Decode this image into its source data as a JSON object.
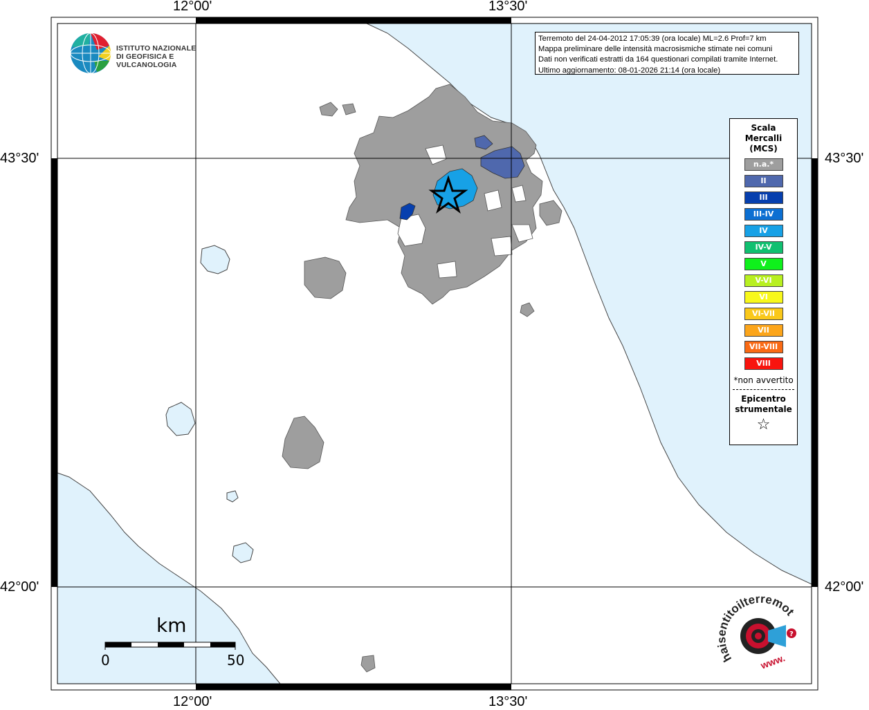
{
  "map": {
    "coordinates": {
      "lon_left": "12°00'",
      "lon_right": "13°30'",
      "lat_top": "43°30'",
      "lat_bottom": "42°00'"
    },
    "colors": {
      "sea": "#e0f2fc",
      "land": "#ffffff",
      "not_felt": "#9e9e9e",
      "II": "#4f68ad",
      "III": "#063fae",
      "IV": "#17a1e6"
    }
  },
  "logo": {
    "org_line1": "ISTITUTO NAZIONALE",
    "org_line2": "DI GEOFISICA E VULCANOLOGIA"
  },
  "info": {
    "line1": "Terremoto del 24-04-2012 17:05:39 (ora locale) ML=2.6 Prof=7 km",
    "line2": "Mappa preliminare delle intensità macrosismiche stimate nei comuni",
    "line3": "Dati non verificati estratti da 164 questionari compilati tramite Internet.",
    "line4": "Ultimo aggiornamento: 08-01-2026 21:14 (ora locale)"
  },
  "legend": {
    "title1": "Scala",
    "title2": "Mercalli",
    "title3": "(MCS)",
    "items": [
      {
        "label": "n.a.*",
        "color": "#9e9e9e"
      },
      {
        "label": "II",
        "color": "#4f68ad"
      },
      {
        "label": "III",
        "color": "#063fae"
      },
      {
        "label": "III-IV",
        "color": "#0c6fd2"
      },
      {
        "label": "IV",
        "color": "#17a1e6"
      },
      {
        "label": "IV-V",
        "color": "#10c070"
      },
      {
        "label": "V",
        "color": "#0ff01c"
      },
      {
        "label": "V-VI",
        "color": "#b8f020"
      },
      {
        "label": "VI",
        "color": "#f8f81a"
      },
      {
        "label": "VI-VII",
        "color": "#fac81a"
      },
      {
        "label": "VII",
        "color": "#fca51a"
      },
      {
        "label": "VII-VIII",
        "color": "#fa6a14"
      },
      {
        "label": "VIII",
        "color": "#f8140e"
      }
    ],
    "note": "*non avvertito",
    "epi1": "Epicentro",
    "epi2": "strumentale",
    "star": "☆"
  },
  "scale": {
    "unit": "km",
    "min": "0",
    "max": "50"
  },
  "website_logo": {
    "text": "haisentitoilterremoto.it",
    "prefix": "www."
  }
}
